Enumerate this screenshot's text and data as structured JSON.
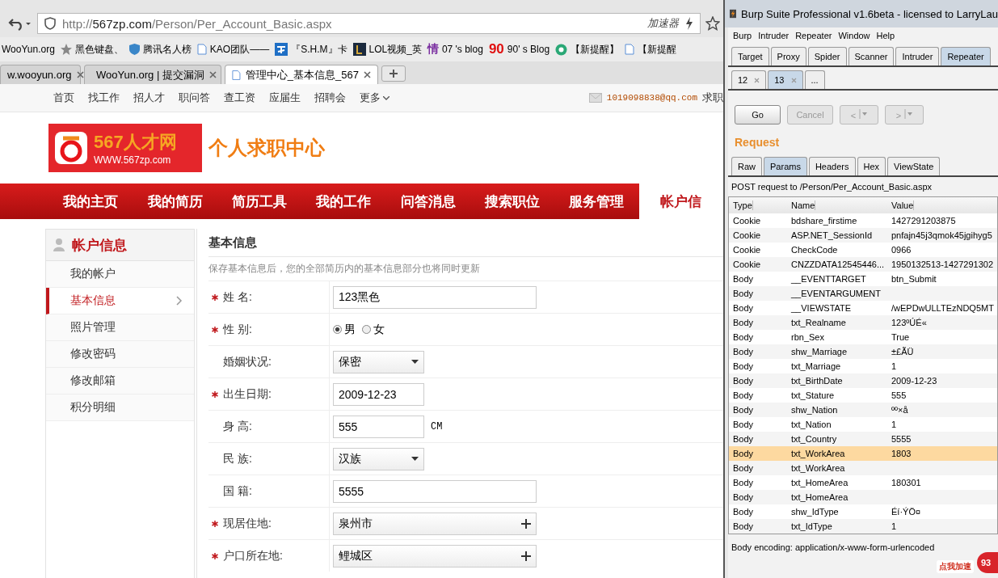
{
  "browser": {
    "url": {
      "scheme": "http://",
      "host": "567zp.com",
      "path": "/Person/Per_Account_Basic.aspx"
    },
    "accelerator": "加速器",
    "bookmarks": [
      {
        "label": "WooYun.org",
        "kind": "plain"
      },
      {
        "label": "黑色键盘、",
        "kind": "star"
      },
      {
        "label": "腾讯名人榜",
        "kind": "shield"
      },
      {
        "label": "KAO团队——",
        "kind": "page"
      },
      {
        "label": "『S.H.M』卡",
        "kind": "square"
      },
      {
        "label": "LOL视频_英",
        "kind": "logo"
      },
      {
        "label": "07 's blog",
        "kind": "glyph",
        "icon_text": "情"
      },
      {
        "label": "90' s Blog",
        "kind": "redglyph",
        "icon_text": "90"
      },
      {
        "label": "【新提醒】",
        "kind": "circle"
      },
      {
        "label": "【新提醒",
        "kind": "page"
      }
    ],
    "tabs": [
      {
        "title": "w.wooyun.org",
        "kind": "plain",
        "selected": false
      },
      {
        "title": "WooYun.org | 提交漏洞",
        "kind": "logo",
        "selected": false
      },
      {
        "title": "管理中心_基本信息_567",
        "kind": "page",
        "selected": true
      }
    ]
  },
  "site": {
    "top_links": [
      "首页",
      "找工作",
      "招人才",
      "职问答",
      "查工资",
      "应届生",
      "招聘会"
    ],
    "more": "更多",
    "email": "1019098838@qq.com",
    "top_right": "求职",
    "logo": {
      "name": "567人才网",
      "domain": "WWW.567zp.com"
    },
    "center_title": "个人求职中心",
    "main_nav": [
      {
        "label": "我的主页",
        "selected": false
      },
      {
        "label": "我的简历",
        "selected": false
      },
      {
        "label": "简历工具",
        "selected": false
      },
      {
        "label": "我的工作",
        "selected": false
      },
      {
        "label": "问答消息",
        "selected": false
      },
      {
        "label": "搜索职位",
        "selected": false
      },
      {
        "label": "服务管理",
        "selected": false
      },
      {
        "label": "帐户信",
        "selected": true
      }
    ],
    "sidebar": {
      "title": "帐户信息",
      "items": [
        {
          "label": "我的帐户",
          "selected": false
        },
        {
          "label": "基本信息",
          "selected": true
        },
        {
          "label": "照片管理",
          "selected": false
        },
        {
          "label": "修改密码",
          "selected": false
        },
        {
          "label": "修改邮箱",
          "selected": false
        },
        {
          "label": "积分明细",
          "selected": false
        }
      ]
    },
    "section_title": "基本信息",
    "note": "保存基本信息后，您的全部简历内的基本信息部分也将同时更新",
    "form": [
      {
        "label": "姓 名:",
        "required": true,
        "kind": "field",
        "value": "123黑色"
      },
      {
        "label": "性 别:",
        "required": true,
        "kind": "radio",
        "options": [
          {
            "label": "男",
            "selected": true
          },
          {
            "label": "女",
            "selected": false
          }
        ]
      },
      {
        "label": "婚姻状况:",
        "required": false,
        "kind": "select",
        "value": "保密"
      },
      {
        "label": "出生日期:",
        "required": true,
        "kind": "shortfield",
        "value": "2009-12-23"
      },
      {
        "label": "身 高:",
        "required": false,
        "kind": "shortfield",
        "value": "555",
        "unit": "CM"
      },
      {
        "label": "民 族:",
        "required": false,
        "kind": "select",
        "value": "汉族"
      },
      {
        "label": "国 籍:",
        "required": false,
        "kind": "field",
        "value": "5555"
      },
      {
        "label": "现居住地:",
        "required": true,
        "kind": "picker",
        "value": "泉州市"
      },
      {
        "label": "户口所在地:",
        "required": true,
        "kind": "picker",
        "value": "鲤城区"
      }
    ]
  },
  "burp": {
    "title": "Burp Suite Professional v1.6beta - licensed to LarryLau",
    "menu": [
      "Burp",
      "Intruder",
      "Repeater",
      "Window",
      "Help"
    ],
    "tabs": [
      {
        "label": "Target",
        "selected": false
      },
      {
        "label": "Proxy",
        "selected": false
      },
      {
        "label": "Spider",
        "selected": false
      },
      {
        "label": "Scanner",
        "selected": false
      },
      {
        "label": "Intruder",
        "selected": false
      },
      {
        "label": "Repeater",
        "selected": true
      }
    ],
    "subtabs": [
      {
        "label": "12",
        "closable": true,
        "selected": false
      },
      {
        "label": "13",
        "closable": true,
        "selected": true
      },
      {
        "label": "...",
        "closable": false,
        "selected": false
      }
    ],
    "buttons": [
      {
        "label": "Go",
        "kind": "text",
        "disabled": false
      },
      {
        "label": "Cancel",
        "kind": "text",
        "disabled": true
      },
      {
        "label": "<",
        "kind": "nav",
        "disabled": true
      },
      {
        "label": ">",
        "kind": "nav",
        "disabled": true
      }
    ],
    "request_heading": "Request",
    "view_tabs": [
      {
        "label": "Raw",
        "selected": false
      },
      {
        "label": "Params",
        "selected": true
      },
      {
        "label": "Headers",
        "selected": false
      },
      {
        "label": "Hex",
        "selected": false
      },
      {
        "label": "ViewState",
        "selected": false
      }
    ],
    "request_line": "POST request to /Person/Per_Account_Basic.aspx",
    "columns": [
      "Type",
      "Name",
      "Value"
    ],
    "rows": [
      {
        "type": "Cookie",
        "name": "bdshare_firstime",
        "value": "1427291203875",
        "selected": false
      },
      {
        "type": "Cookie",
        "name": "ASP.NET_SessionId",
        "value": "pnfajn45j3qmok45jgihyg5",
        "selected": false
      },
      {
        "type": "Cookie",
        "name": "CheckCode",
        "value": "0966",
        "selected": false
      },
      {
        "type": "Cookie",
        "name": "CNZZDATA12545446...",
        "value": "1950132513-1427291302",
        "selected": false
      },
      {
        "type": "Body",
        "name": "__EVENTTARGET",
        "value": "btn_Submit",
        "selected": false
      },
      {
        "type": "Body",
        "name": "__EVENTARGUMENT",
        "value": "",
        "selected": false
      },
      {
        "type": "Body",
        "name": "__VIEWSTATE",
        "value": "/wEPDwULLTEzNDQ5MT",
        "selected": false
      },
      {
        "type": "Body",
        "name": "txt_Realname",
        "value": "123ºÚÉ«",
        "selected": false
      },
      {
        "type": "Body",
        "name": "rbn_Sex",
        "value": "True",
        "selected": false
      },
      {
        "type": "Body",
        "name": "shw_Marriage",
        "value": "±£ÃÜ",
        "selected": false
      },
      {
        "type": "Body",
        "name": "txt_Marriage",
        "value": "1",
        "selected": false
      },
      {
        "type": "Body",
        "name": "txt_BirthDate",
        "value": "2009-12-23",
        "selected": false
      },
      {
        "type": "Body",
        "name": "txt_Stature",
        "value": "555",
        "selected": false
      },
      {
        "type": "Body",
        "name": "shw_Nation",
        "value": "ºº×å",
        "selected": false
      },
      {
        "type": "Body",
        "name": "txt_Nation",
        "value": "1",
        "selected": false
      },
      {
        "type": "Body",
        "name": "txt_Country",
        "value": "5555",
        "selected": false
      },
      {
        "type": "Body",
        "name": "txt_WorkArea",
        "value": "1803",
        "selected": true
      },
      {
        "type": "Body",
        "name": "txt_WorkArea",
        "value": "",
        "selected": false
      },
      {
        "type": "Body",
        "name": "txt_HomeArea",
        "value": "180301",
        "selected": false
      },
      {
        "type": "Body",
        "name": "txt_HomeArea",
        "value": "",
        "selected": false
      },
      {
        "type": "Body",
        "name": "shw_IdType",
        "value": "Éí·ÝÖ¤",
        "selected": false
      },
      {
        "type": "Body",
        "name": "txt_IdType",
        "value": "1",
        "selected": false
      }
    ],
    "body_encoding": "Body encoding: application/x-www-form-urlencoded",
    "speed_badge": {
      "label": "点我加速",
      "count": "93"
    }
  }
}
